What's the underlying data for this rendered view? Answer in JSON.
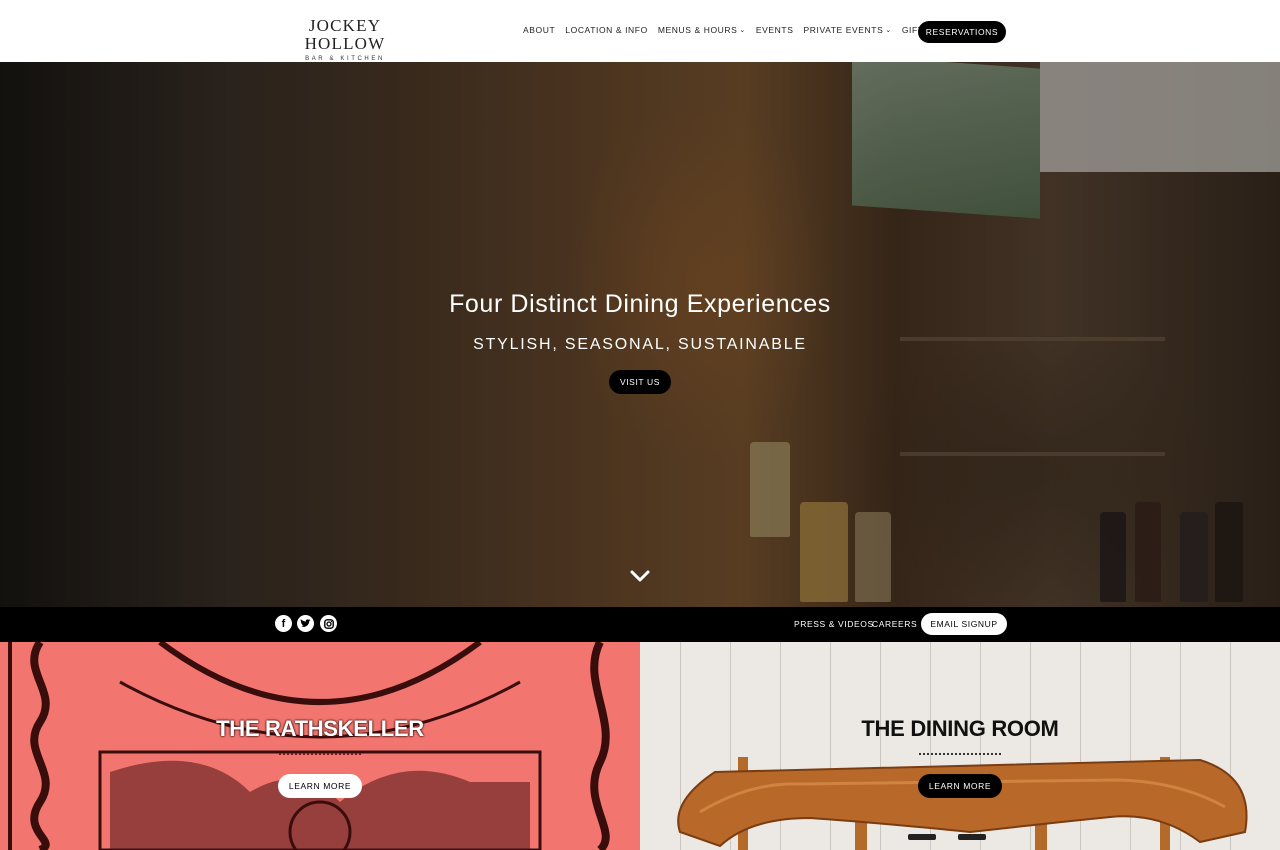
{
  "header": {
    "logo_main": "JOCKEY HOLLOW",
    "logo_sub": "BAR & KITCHEN",
    "nav": [
      {
        "label": "ABOUT",
        "has_dropdown": false
      },
      {
        "label": "LOCATION & INFO",
        "has_dropdown": false
      },
      {
        "label": "MENUS & HOURS",
        "has_dropdown": true
      },
      {
        "label": "EVENTS",
        "has_dropdown": false
      },
      {
        "label": "PRIVATE EVENTS",
        "has_dropdown": true
      },
      {
        "label": "GIFT CARDS",
        "has_dropdown": false
      }
    ],
    "reservations_label": "RESERVATIONS"
  },
  "hero": {
    "title": "Four Distinct Dining Experiences",
    "subtitle": "STYLISH, SEASONAL, SUSTAINABLE",
    "cta_label": "VISIT US",
    "scroll_icon": "chevron-down-icon"
  },
  "footer_bar": {
    "social": [
      {
        "name": "facebook-icon",
        "glyph": "f"
      },
      {
        "name": "twitter-icon",
        "glyph": "t"
      },
      {
        "name": "instagram-icon",
        "glyph": "i"
      }
    ],
    "links": [
      "PRESS & VIDEOS",
      "CAREERS"
    ],
    "email_signup_label": "EMAIL SIGNUP"
  },
  "sections": [
    {
      "title": "THE RATHSKELLER",
      "cta_label": "LEARN MORE",
      "accent": "#f2766f"
    },
    {
      "title": "THE DINING ROOM",
      "cta_label": "LEARN MORE",
      "accent": "#ece9e4"
    }
  ],
  "colors": {
    "black": "#000000",
    "white": "#ffffff",
    "rathskeller_pink": "#f2766f"
  }
}
